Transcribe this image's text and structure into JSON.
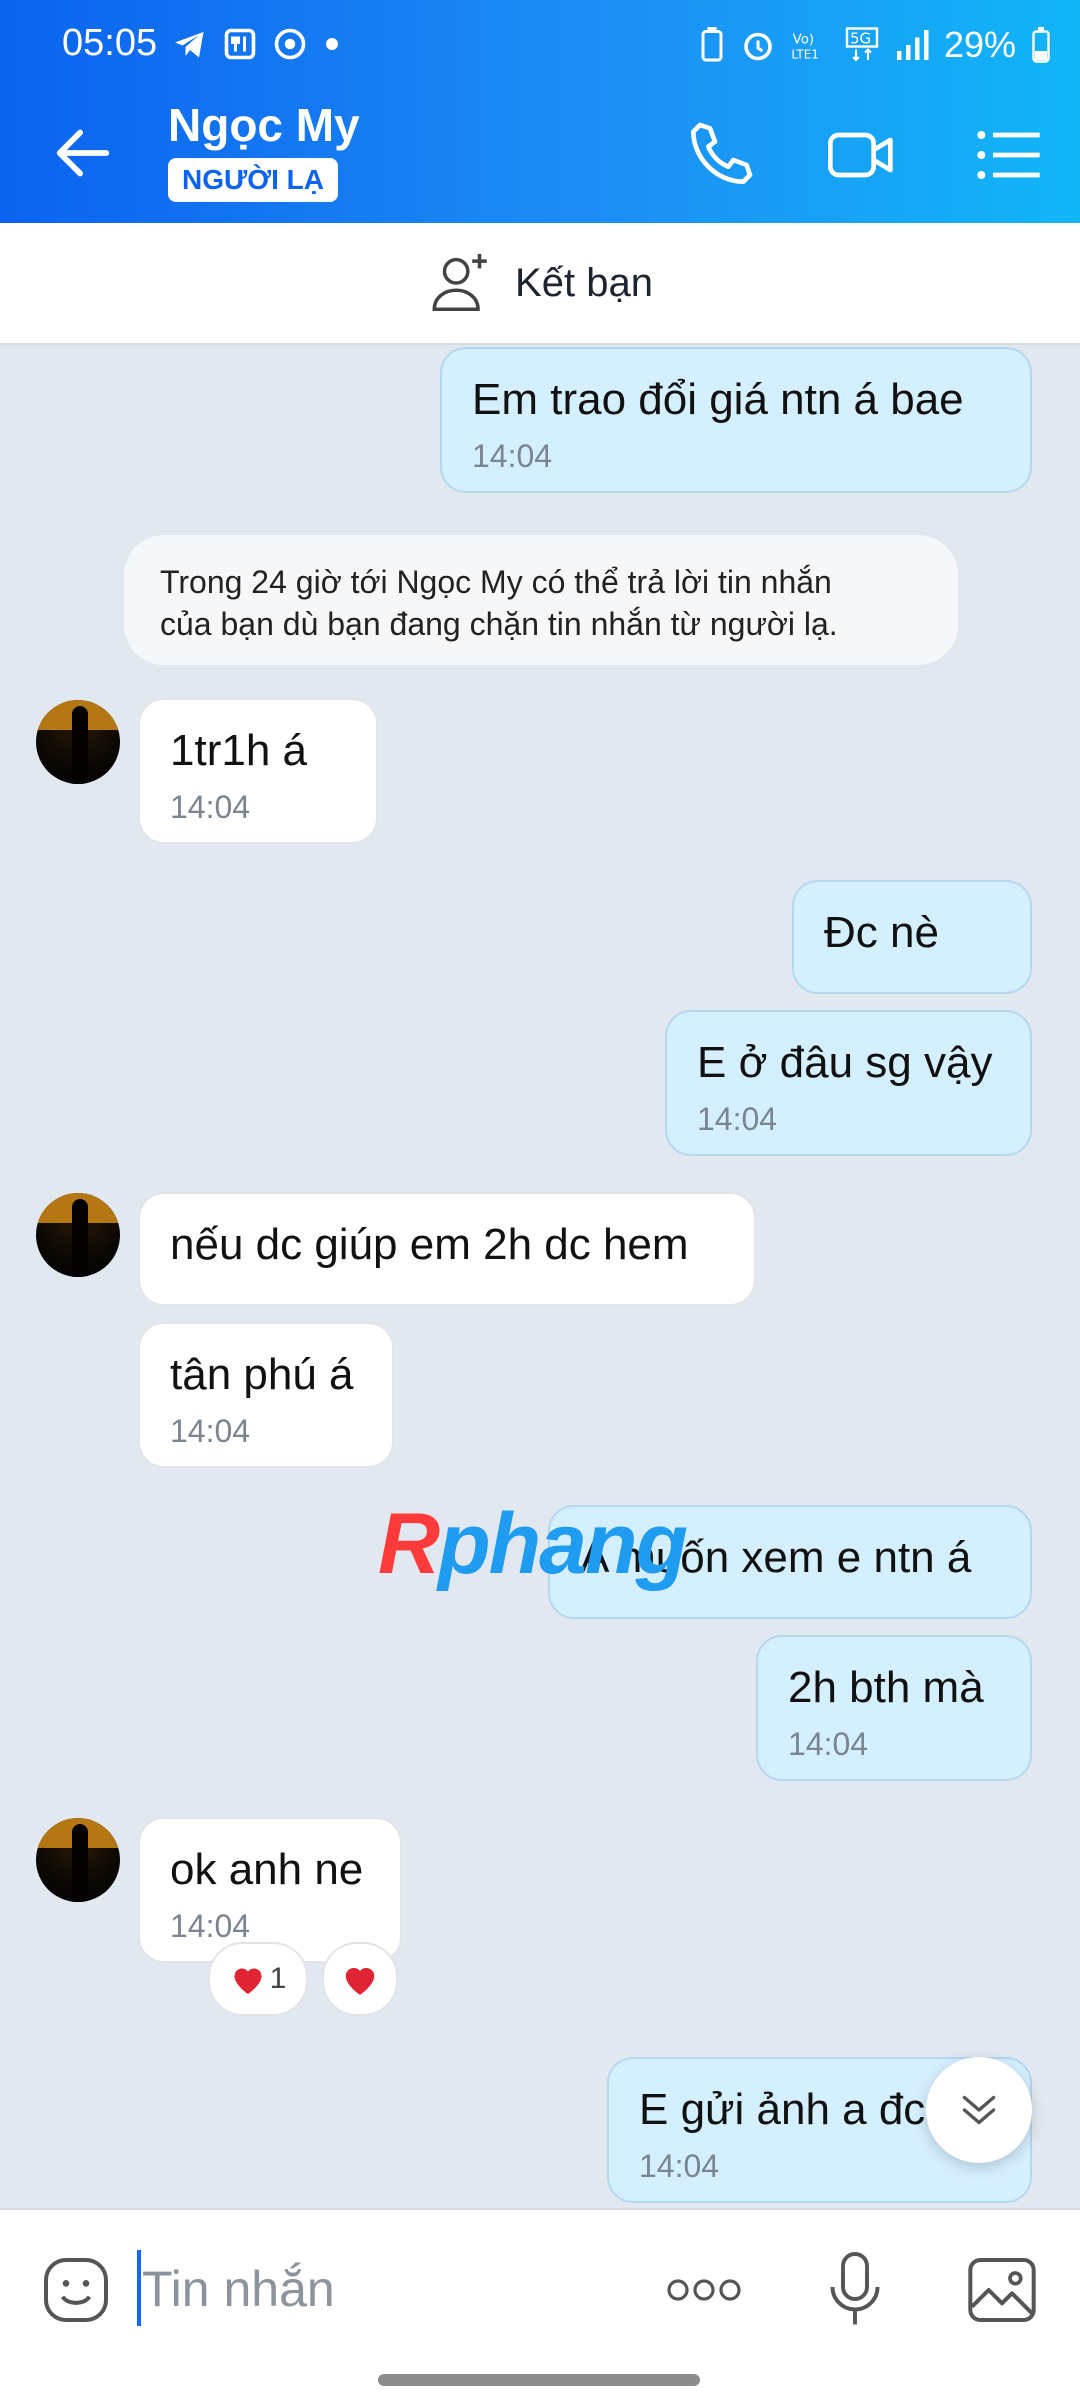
{
  "status_bar": {
    "time": "05:05",
    "battery": "29%"
  },
  "header": {
    "contact_name": "Ngọc My",
    "badge": "NGƯỜI LẠ"
  },
  "friend_bar": {
    "label": "Kết bạn"
  },
  "system_note": {
    "line1": "Trong 24 giờ tới Ngọc My có thể trả lời tin nhắn",
    "line2": "của bạn dù bạn đang chặn tin nhắn từ người lạ."
  },
  "messages": [
    {
      "dir": "out",
      "text": "Em trao đổi giá ntn á bae",
      "time": "14:04"
    },
    {
      "dir": "in",
      "text": "1tr1h á",
      "time": "14:04"
    },
    {
      "dir": "out",
      "text": "Đc nè",
      "time": ""
    },
    {
      "dir": "out",
      "text": "E ở đâu sg vậy",
      "time": "14:04"
    },
    {
      "dir": "in",
      "text": "nếu dc giúp em 2h dc hem",
      "time": ""
    },
    {
      "dir": "in",
      "text": "tân phú á",
      "time": "14:04"
    },
    {
      "dir": "out",
      "text": "A muốn xem e ntn á",
      "time": ""
    },
    {
      "dir": "out",
      "text": "2h bth mà",
      "time": "14:04"
    },
    {
      "dir": "in",
      "text": "ok anh ne",
      "time": "14:04"
    },
    {
      "dir": "out",
      "text": "E gửi ảnh a đc",
      "time": "14:04"
    }
  ],
  "reactions": {
    "count": "1"
  },
  "watermark": {
    "part1": "R",
    "part2": "phang"
  },
  "composer": {
    "placeholder": "Tin nhắn"
  },
  "colors": {
    "header_start": "#0b63ef",
    "header_end": "#11b6f7",
    "outgoing_bubble": "#d4efff",
    "incoming_bubble": "#ffffff",
    "chat_bg": "#e2e8f0"
  }
}
